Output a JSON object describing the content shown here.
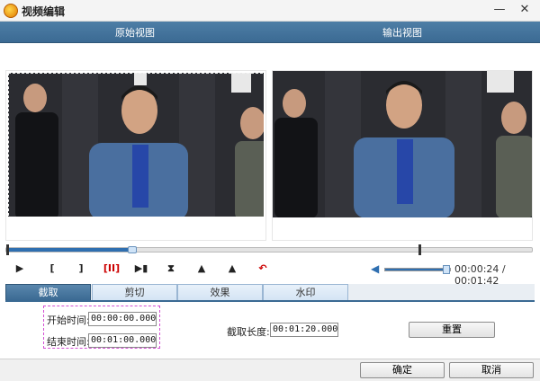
{
  "window": {
    "title": "视频编辑",
    "min_glyph": "—",
    "close_glyph": "✕"
  },
  "preview": {
    "original_label": "原始视图",
    "output_label": "输出视图"
  },
  "playback": {
    "progress_fraction": 0.24,
    "volume_fraction": 1.0,
    "time_display": "00:00:24 / 00:01:42",
    "controls": {
      "play": "▶",
      "mark_in": "[",
      "mark_out": "]",
      "clip": "[II]",
      "next_frame": "▶▮",
      "icon_a": "⧗",
      "icon_b": "▲",
      "icon_c": "▲",
      "undo": "↶"
    }
  },
  "tabs": [
    "截取",
    "剪切",
    "效果",
    "水印"
  ],
  "trim": {
    "start_label": "开始时间:",
    "start_value": "00:00:00.000",
    "end_label": "结束时间:",
    "end_value": "00:01:00.000",
    "length_label": "截取长度:",
    "length_value": "00:01:20.000",
    "reset_label": "重置"
  },
  "buttons": {
    "ok": "确定",
    "cancel": "取消"
  },
  "colors": {
    "accent": "#3b6a93",
    "timeline": "#2f6fb0"
  }
}
